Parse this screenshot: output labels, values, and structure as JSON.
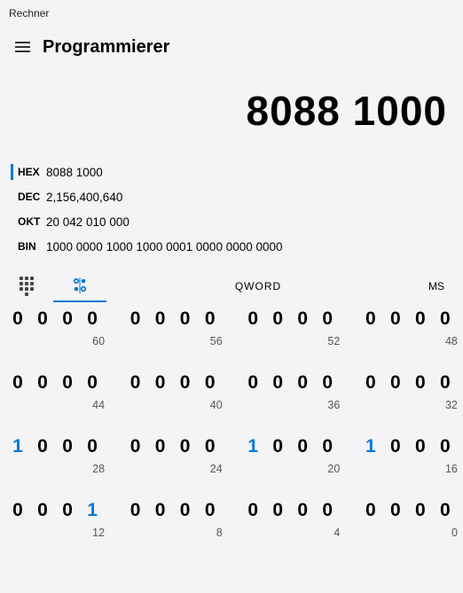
{
  "window": {
    "title": "Rechner"
  },
  "header": {
    "mode": "Programmierer"
  },
  "display": {
    "value": "8088 1000"
  },
  "bases": {
    "hex": {
      "label": "HEX",
      "value": "8088 1000",
      "active": true
    },
    "dec": {
      "label": "DEC",
      "value": "2,156,400,640",
      "active": false
    },
    "okt": {
      "label": "OKT",
      "value": "20 042 010 000",
      "active": false
    },
    "bin": {
      "label": "BIN",
      "value": "1000 0000 1000 1000 0001 0000 0000 0000",
      "active": false
    }
  },
  "toolbar": {
    "keypad_icon": "keypad-icon",
    "bits_icon": "bit-toggle-icon",
    "word_size": "QWORD",
    "memory": "MS"
  },
  "bit_rows": [
    {
      "bits": [
        "0",
        "0",
        "0",
        "0",
        "0",
        "0",
        "0",
        "0",
        "0",
        "0",
        "0",
        "0",
        "0",
        "0",
        "0",
        "0"
      ],
      "indices": [
        60,
        56,
        52,
        48
      ]
    },
    {
      "bits": [
        "0",
        "0",
        "0",
        "0",
        "0",
        "0",
        "0",
        "0",
        "0",
        "0",
        "0",
        "0",
        "0",
        "0",
        "0",
        "0"
      ],
      "indices": [
        44,
        40,
        36,
        32
      ]
    },
    {
      "bits": [
        "1",
        "0",
        "0",
        "0",
        "0",
        "0",
        "0",
        "0",
        "1",
        "0",
        "0",
        "0",
        "1",
        "0",
        "0",
        "0"
      ],
      "indices": [
        28,
        24,
        20,
        16
      ]
    },
    {
      "bits": [
        "0",
        "0",
        "0",
        "1",
        "0",
        "0",
        "0",
        "0",
        "0",
        "0",
        "0",
        "0",
        "0",
        "0",
        "0",
        "0"
      ],
      "indices": [
        12,
        8,
        4,
        0
      ]
    }
  ]
}
